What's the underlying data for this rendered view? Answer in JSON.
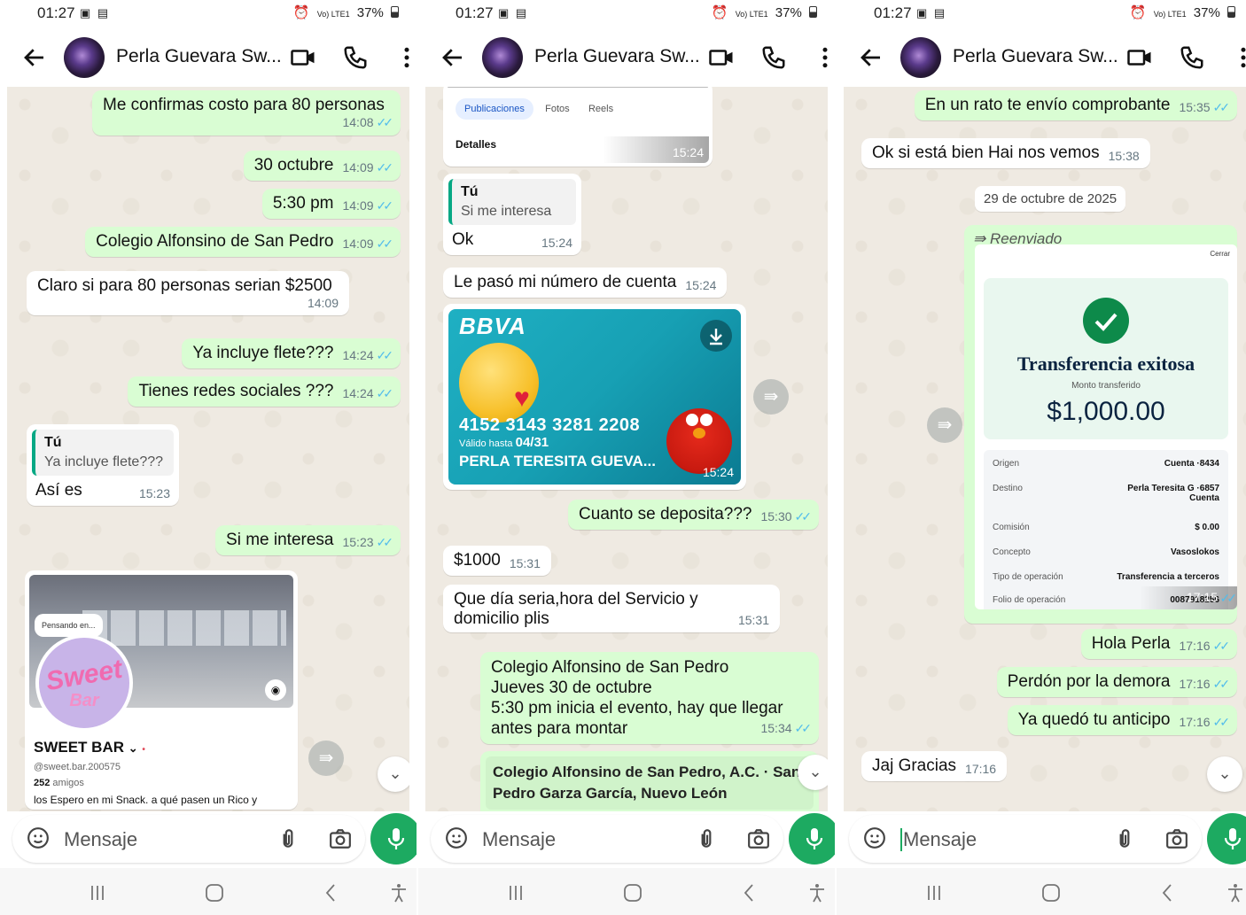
{
  "status": {
    "time": "01:27",
    "battery": "37%",
    "signal": "Vo) LTE1"
  },
  "chat": {
    "contact": "Perla Guevara Sw..."
  },
  "input": {
    "placeholder": "Mensaje"
  },
  "screen1": {
    "messages": [
      {
        "text": "Me confirmas costo para 80 personas",
        "time": "14:08"
      },
      {
        "text": "30 octubre",
        "time": "14:09"
      },
      {
        "text": "5:30 pm",
        "time": "14:09"
      },
      {
        "text": "Colegio Alfonsino de San Pedro",
        "time": "14:09"
      },
      {
        "text": "Claro si para 80 personas serian $2500",
        "time": "14:09"
      },
      {
        "text": "Ya incluye flete???",
        "time": "14:24"
      },
      {
        "text": "Tienes redes sociales ???",
        "time": "14:24"
      },
      {
        "quote_author": "Tú",
        "quote_text": "Ya incluye flete???",
        "text": "Así es",
        "time": "15:23"
      },
      {
        "text": "Si me interesa",
        "time": "15:23"
      }
    ],
    "profile_card": {
      "thought": "Pensando en...",
      "logo_top": "Sweet",
      "logo_bottom": "Bar",
      "name": "SWEET BAR",
      "handle": "@sweet.bar.200575",
      "friends_count": "252",
      "friends_label": "amigos",
      "bio": "los Espero en mi Snack. a qué pasen un Rico y"
    }
  },
  "screen2": {
    "fb_preview": {
      "tabs": [
        "Publicaciones",
        "Fotos",
        "Reels"
      ],
      "section": "Detalles",
      "time": "15:24"
    },
    "messages": [
      {
        "quote_author": "Tú",
        "quote_text": "Si me interesa",
        "text": "Ok",
        "time": "15:24"
      },
      {
        "text": "Le pasó mi número de cuenta",
        "time": "15:24"
      },
      {
        "text": "Cuanto se deposita???",
        "time": "15:30"
      },
      {
        "text": "$1000",
        "time": "15:31"
      },
      {
        "text": "Que día seria,hora del Servicio y domicilio plis",
        "time": "15:31"
      },
      {
        "lines": [
          "Colegio Alfonsino de San Pedro",
          "Jueves 30 de octubre",
          "5:30 pm inicia el evento, hay que llegar",
          "antes para montar"
        ],
        "time": "15:34"
      },
      {
        "text": "Colegio Alfonsino de San Pedro, A.C. · San Pedro Garza García, Nuevo León"
      }
    ],
    "card": {
      "bank": "BBVA",
      "number": "4152 3143 3281 2208",
      "valid_label": "Válido hasta",
      "valid": "04/31",
      "holder": "PERLA TERESITA GUEVA...",
      "time": "15:24"
    }
  },
  "screen3": {
    "messages": [
      {
        "text": "En un rato te envío comprobante",
        "time": "15:35"
      },
      {
        "text": "Ok si está bien Hai nos vemos",
        "time": "15:38"
      },
      {
        "text": "Hola Perla",
        "time": "17:16"
      },
      {
        "text": "Perdón por la demora",
        "time": "17:16"
      },
      {
        "text": "Ya quedó tu anticipo",
        "time": "17:16"
      },
      {
        "text": "Jaj Gracias",
        "time": "17:16"
      }
    ],
    "date_chip": "29 de octubre de 2025",
    "forwarded": "Reenviado",
    "receipt": {
      "close": "Cerrar",
      "title": "Transferencia exitosa",
      "subtitle": "Monto transferido",
      "amount": "$1,000.00",
      "rows": [
        {
          "label": "Origen",
          "value": "Cuenta ·8434"
        },
        {
          "label": "Destino",
          "value": "Perla Teresita G ·6857",
          "value2": "Cuenta"
        },
        {
          "label": "Comisión",
          "value": "$ 0.00"
        },
        {
          "label": "Concepto",
          "value": "Vasoslokos"
        },
        {
          "label": "Tipo de operación",
          "value": "Transferencia a terceros"
        },
        {
          "label": "Folio de operación",
          "value": "0087918256"
        }
      ],
      "time": "17:15"
    }
  },
  "colors": {
    "outgoing": "#d9fdd3",
    "incoming": "#ffffff",
    "accent": "#1daa61",
    "ticks": "#53bdeb",
    "wallpaper": "#efeae2"
  },
  "icons": [
    "back-arrow-icon",
    "video-call-icon",
    "phone-icon",
    "more-vert-icon",
    "sticker-icon",
    "attach-icon",
    "camera-icon",
    "mic-icon",
    "forward-icon",
    "chevron-down-icon",
    "download-icon",
    "check-icon"
  ]
}
